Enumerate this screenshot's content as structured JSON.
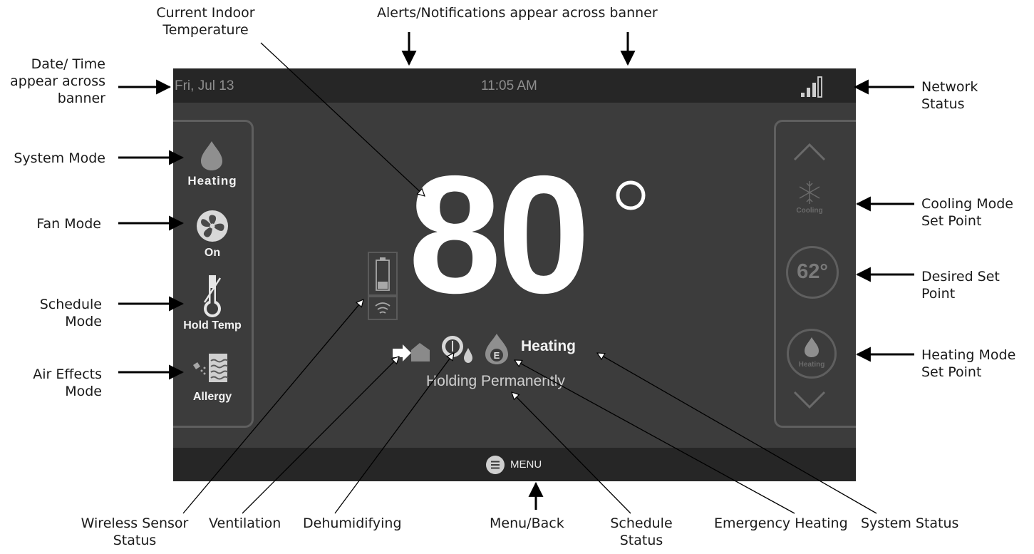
{
  "callouts": {
    "current_temp": "Current Indoor\nTemperature",
    "alerts": "Alerts/Notifications appear across banner",
    "date_time": "Date/ Time\nappear across\nbanner",
    "network_status": "Network\nStatus",
    "system_mode": "System Mode",
    "fan_mode": "Fan Mode",
    "schedule_mode": "Schedule\nMode",
    "air_effects_mode": "Air Effects\nMode",
    "cooling_set_point": "Cooling Mode\nSet Point",
    "desired_set_point": "Desired Set\nPoint",
    "heating_set_point": "Heating Mode\nSet Point",
    "wireless_sensor": "Wireless Sensor\nStatus",
    "ventilation": "Ventilation",
    "dehumidifying": "Dehumidifying",
    "menu_back": "Menu/Back",
    "schedule_status": "Schedule\nStatus",
    "emergency_heating": "Emergency Heating",
    "system_status": "System Status"
  },
  "screen": {
    "date": "Fri, Jul 13",
    "time": "11:05 AM",
    "temperature": "80",
    "system_mode_label": "Heating",
    "fan_mode_label": "On",
    "schedule_mode_label": "Hold Temp",
    "air_effects_label": "Allergy",
    "system_status_label": "Heating",
    "schedule_status_label": "Holding Permanently",
    "cooling_label": "Cooling",
    "desired_set_point": "62°",
    "heating_label": "Heating",
    "menu_label": "MENU"
  },
  "colors": {
    "screen_bg": "#3c3c3c",
    "banner_bg": "#262626",
    "panel_border": "#5f5f5f",
    "text_dim": "#8e8e8e"
  },
  "icons": [
    "flame-icon",
    "fan-icon",
    "thermometer-icon",
    "air-effects-icon",
    "battery-icon",
    "wireless-icon",
    "ventilation-icon",
    "dehumidify-icon",
    "emergency-heat-icon",
    "snowflake-icon",
    "signal-bars-icon",
    "chevron-up-icon",
    "chevron-down-icon",
    "menu-icon"
  ]
}
